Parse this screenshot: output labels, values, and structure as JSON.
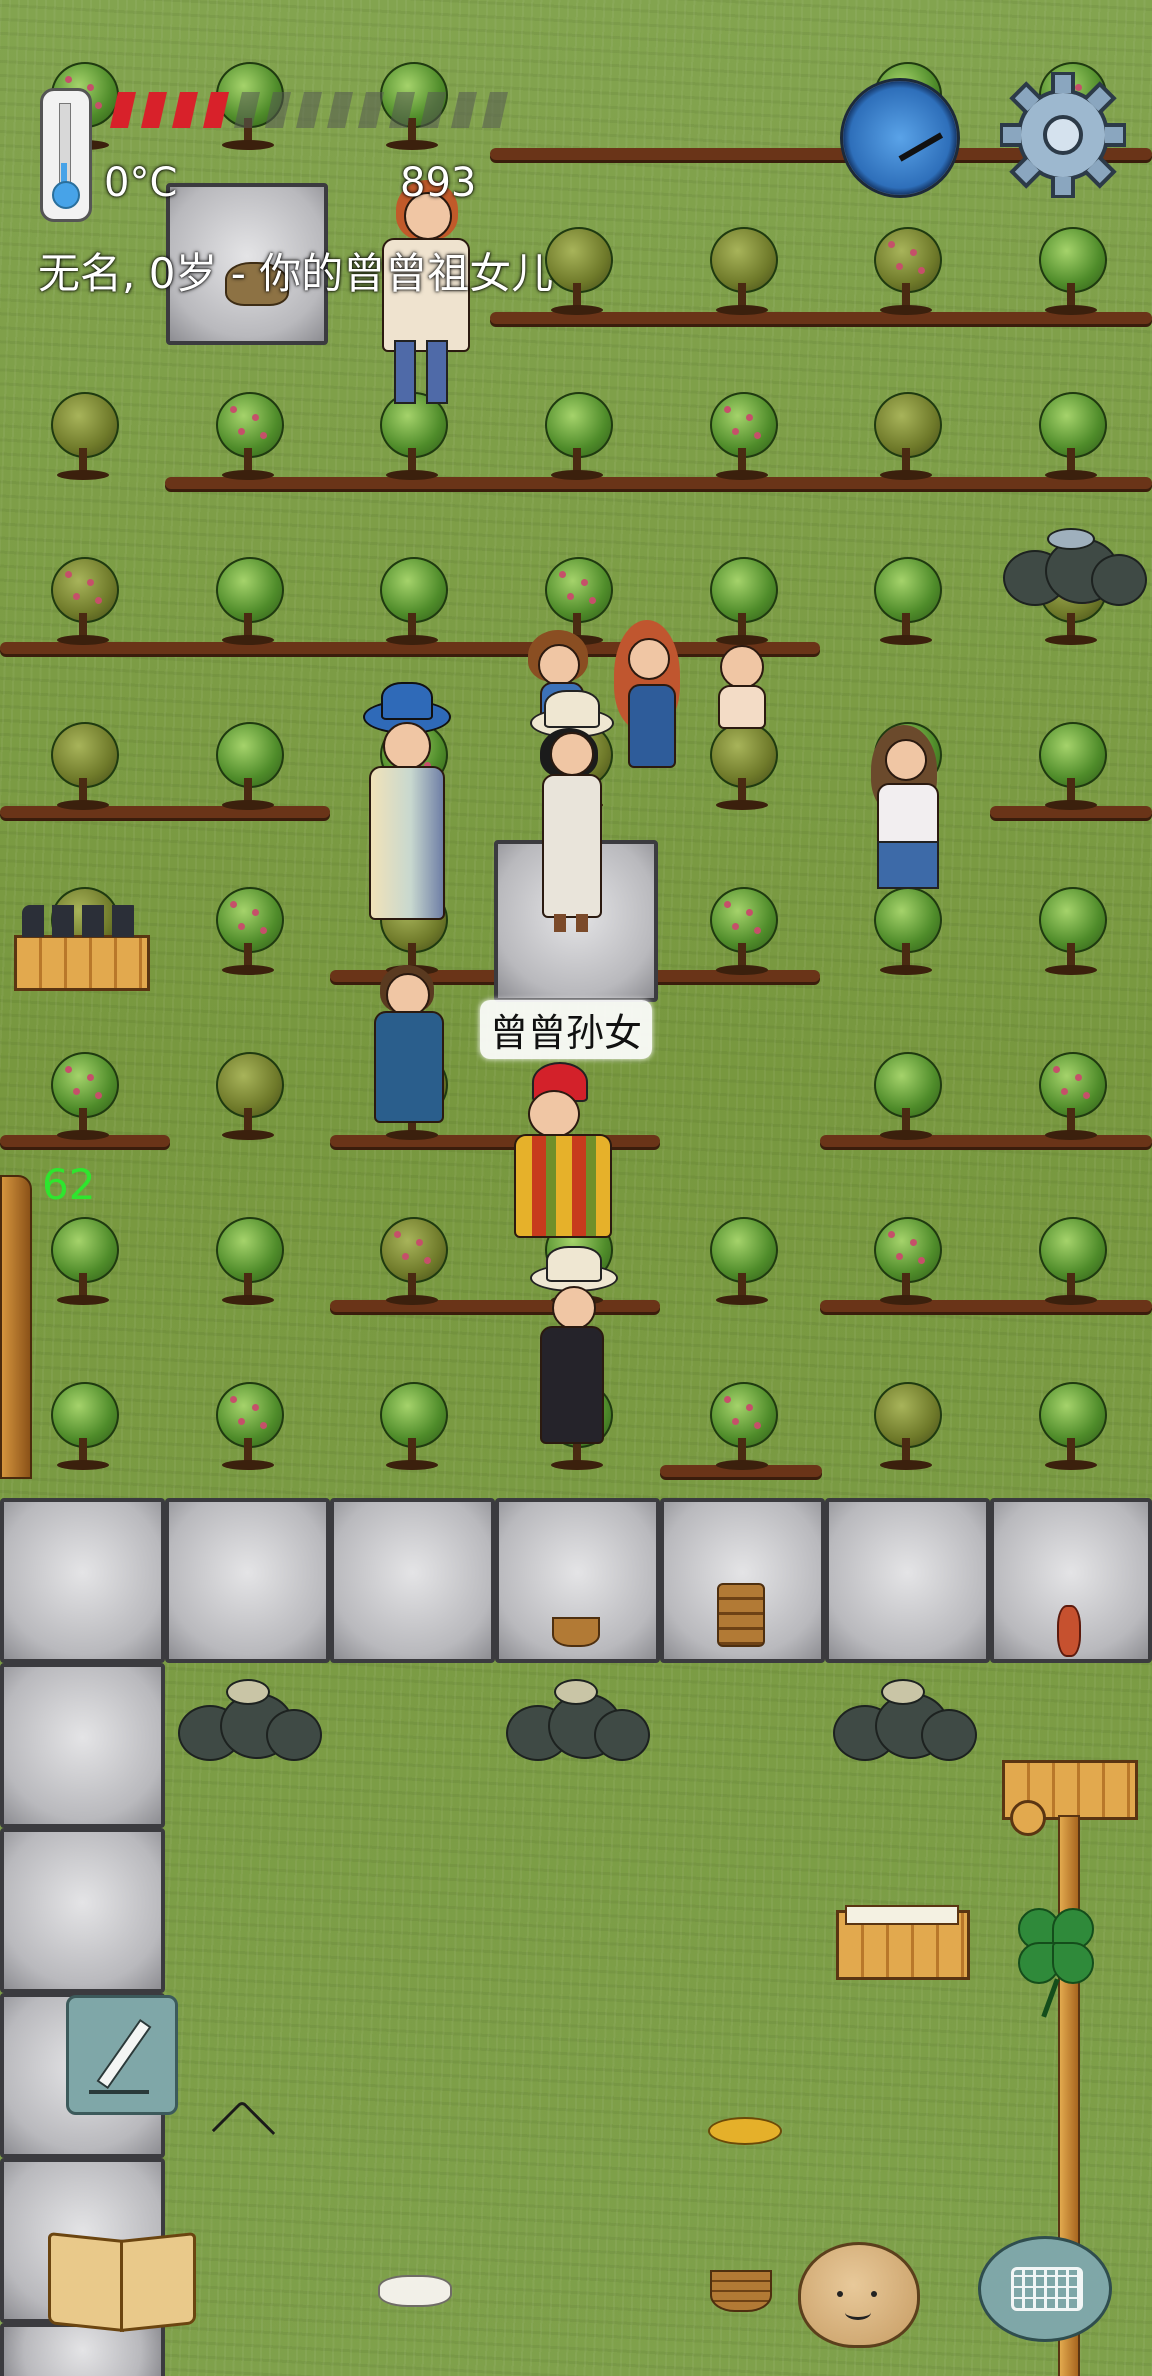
{
  "hud": {
    "temperature": "0°C",
    "score": "893",
    "player_status": "无名, 0岁 - 你的曾曾祖女儿",
    "yum_counter": "62",
    "food_bar": {
      "filled_segments": 4,
      "total_segments": 13,
      "color_filled": "#d8212a",
      "color_empty": "#555a52"
    }
  },
  "world": {
    "name_tag": "曾曾孙女"
  },
  "icons": {
    "thermometer": "thermometer-icon",
    "compass": "compass-icon",
    "settings": "gear-icon",
    "edit": "pencil-icon",
    "book": "book-icon",
    "emote": "face-icon",
    "keyboard": "keyboard-icon",
    "clover": "clover-icon"
  },
  "colors": {
    "grass": "#7fa14b",
    "soil": "#6a3418",
    "accent_green_text": "#2ee62e"
  }
}
